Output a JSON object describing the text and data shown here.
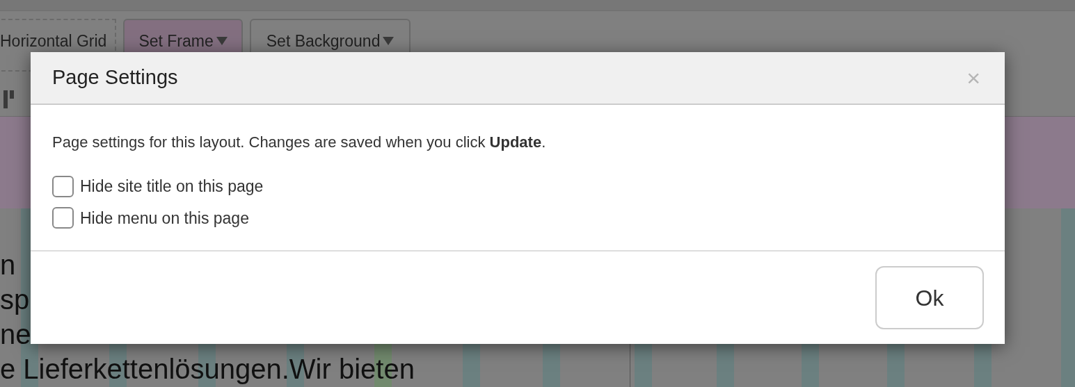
{
  "background": {
    "toolbar": [
      {
        "label": "Horizontal Grid",
        "kind": "dashed",
        "caret": false
      },
      {
        "label": "Set Frame",
        "kind": "active",
        "caret": true
      },
      {
        "label": "Set Background",
        "kind": "plain",
        "caret": true
      }
    ],
    "text_lines": [
      "n",
      "sp",
      "ne",
      "e Lieferkettenlösungen.Wir bieten"
    ]
  },
  "dialog": {
    "title": "Page Settings",
    "close": "×",
    "intro": "Page settings for this layout. Changes are saved when you click **Update**.",
    "options": [
      {
        "label": "Hide site title on this page",
        "checked": false
      },
      {
        "label": "Hide menu on this page",
        "checked": false
      }
    ],
    "buttons": [
      "Ok"
    ]
  }
}
